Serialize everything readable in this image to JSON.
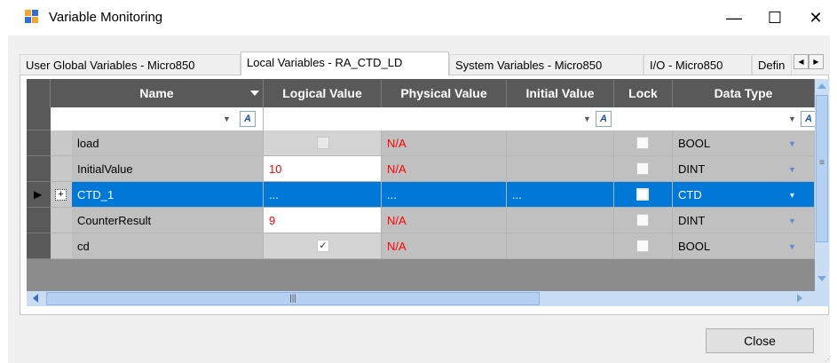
{
  "window": {
    "title": "Variable Monitoring",
    "minimize_glyph": "—",
    "maximize_glyph": "☐",
    "close_glyph": "✕"
  },
  "tabs": [
    {
      "label": "User Global Variables - Micro850",
      "active": false
    },
    {
      "label": "Local Variables - RA_CTD_LD",
      "active": true
    },
    {
      "label": "System Variables - Micro850",
      "active": false
    },
    {
      "label": "I/O - Micro850",
      "active": false
    },
    {
      "label": "Defin",
      "active": false
    }
  ],
  "tab_scroll": {
    "left": "◀",
    "right": "▶"
  },
  "grid": {
    "columns": [
      "Name",
      "Logical Value",
      "Physical Value",
      "Initial Value",
      "Lock",
      "Data Type"
    ],
    "filter_icon_label": "A",
    "rows": [
      {
        "name": "load",
        "logical": "",
        "logical_checkbox": "unchecked",
        "physical": "N/A",
        "initial": "",
        "lock": false,
        "type": "BOOL",
        "selected": false,
        "expander": ""
      },
      {
        "name": "InitialValue",
        "logical": "10",
        "physical": "N/A",
        "initial": "",
        "lock": false,
        "type": "DINT",
        "selected": false,
        "expander": ""
      },
      {
        "name": "CTD_1",
        "logical": "...",
        "physical": "...",
        "initial": "...",
        "lock": false,
        "type": "CTD",
        "selected": true,
        "expander": "+"
      },
      {
        "name": "CounterResult",
        "logical": "9",
        "physical": "N/A",
        "initial": "",
        "lock": false,
        "type": "DINT",
        "selected": false,
        "expander": ""
      },
      {
        "name": "cd",
        "logical": "",
        "logical_checkbox": "checked",
        "physical": "N/A",
        "initial": "",
        "lock": false,
        "type": "BOOL",
        "selected": false,
        "expander": ""
      }
    ],
    "current_row_marker": "▶"
  },
  "buttons": {
    "close": "Close"
  },
  "colors": {
    "header_bg": "#595959",
    "selection": "#0078d7",
    "value_red": "#ff0000",
    "icon_orange": "#f5a623",
    "icon_blue": "#2f6fd6"
  }
}
